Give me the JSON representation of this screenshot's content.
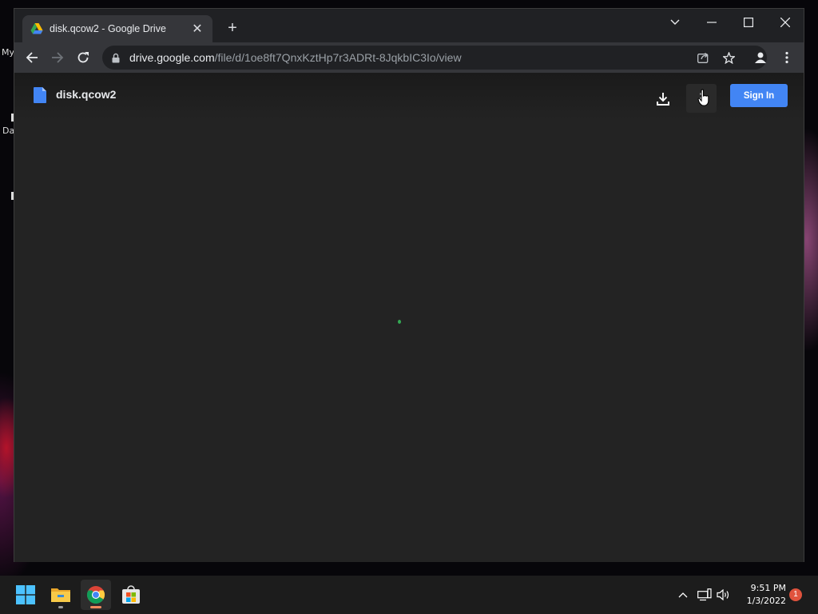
{
  "desktop": {
    "label_top": "My",
    "label_mid": "Da"
  },
  "browser": {
    "tab": {
      "title": "disk.qcow2 - Google Drive"
    },
    "address_bar": {
      "domain": "drive.google.com",
      "path": "/file/d/1oe8ft7QnxKztHp7r3ADRt-8JqkbIC3Io/view"
    }
  },
  "drive": {
    "file_name": "disk.qcow2",
    "signin_label": "Sign In"
  },
  "taskbar": {
    "time": "9:51 PM",
    "date": "1/3/2022",
    "notification_count": "1"
  },
  "colors": {
    "accent": "#4285f4",
    "page_bg": "#232323",
    "chrome_bg": "#202124",
    "toolbar_bg": "#35363a"
  }
}
